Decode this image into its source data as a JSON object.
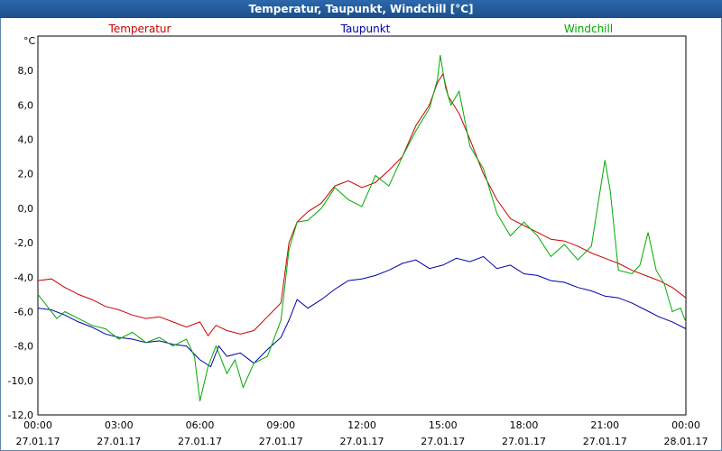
{
  "window": {
    "title": "Temperatur, Taupunkt, Windchill [°C]"
  },
  "chart_data": {
    "type": "line",
    "title": "Temperatur, Taupunkt, Windchill [°C]",
    "ylabel": "°C",
    "ylim": [
      -12,
      10
    ],
    "xlim": [
      0,
      24
    ],
    "yticks": [
      "-12,0",
      "-10,0",
      "-8,0",
      "-6,0",
      "-4,0",
      "-2,0",
      "0,0",
      "2,0",
      "4,0",
      "6,0",
      "8,0"
    ],
    "xticks": [
      {
        "time": "00:00",
        "date": "27.01.17"
      },
      {
        "time": "03:00",
        "date": "27.01.17"
      },
      {
        "time": "06:00",
        "date": "27.01.17"
      },
      {
        "time": "09:00",
        "date": "27.01.17"
      },
      {
        "time": "12:00",
        "date": "27.01.17"
      },
      {
        "time": "15:00",
        "date": "27.01.17"
      },
      {
        "time": "18:00",
        "date": "27.01.17"
      },
      {
        "time": "21:00",
        "date": "27.01.17"
      },
      {
        "time": "00:00",
        "date": "28.01.17"
      }
    ],
    "grid": true,
    "legend_position": "top",
    "series": [
      {
        "name": "Temperatur",
        "color": "#cc0000",
        "points": [
          [
            0,
            -4.2
          ],
          [
            0.5,
            -4.1
          ],
          [
            1,
            -4.6
          ],
          [
            1.5,
            -5.0
          ],
          [
            2,
            -5.3
          ],
          [
            2.5,
            -5.7
          ],
          [
            3,
            -5.9
          ],
          [
            3.5,
            -6.2
          ],
          [
            4,
            -6.4
          ],
          [
            4.5,
            -6.3
          ],
          [
            5,
            -6.6
          ],
          [
            5.5,
            -6.9
          ],
          [
            6,
            -6.6
          ],
          [
            6.3,
            -7.4
          ],
          [
            6.6,
            -6.8
          ],
          [
            7,
            -7.1
          ],
          [
            7.5,
            -7.3
          ],
          [
            8,
            -7.1
          ],
          [
            8.5,
            -6.3
          ],
          [
            9,
            -5.5
          ],
          [
            9.3,
            -2.0
          ],
          [
            9.6,
            -0.8
          ],
          [
            10,
            -0.2
          ],
          [
            10.5,
            0.3
          ],
          [
            11,
            1.3
          ],
          [
            11.5,
            1.6
          ],
          [
            12,
            1.2
          ],
          [
            12.5,
            1.5
          ],
          [
            13,
            2.2
          ],
          [
            13.5,
            3.0
          ],
          [
            14,
            4.8
          ],
          [
            14.5,
            6.0
          ],
          [
            14.8,
            7.3
          ],
          [
            15,
            7.8
          ],
          [
            15.2,
            6.5
          ],
          [
            15.6,
            5.5
          ],
          [
            16,
            4.0
          ],
          [
            16.5,
            2.0
          ],
          [
            17,
            0.5
          ],
          [
            17.5,
            -0.6
          ],
          [
            18,
            -1.0
          ],
          [
            18.5,
            -1.4
          ],
          [
            19,
            -1.8
          ],
          [
            19.5,
            -1.9
          ],
          [
            20,
            -2.2
          ],
          [
            20.5,
            -2.6
          ],
          [
            21,
            -2.9
          ],
          [
            21.5,
            -3.2
          ],
          [
            22,
            -3.6
          ],
          [
            22.5,
            -3.9
          ],
          [
            23,
            -4.2
          ],
          [
            23.5,
            -4.6
          ],
          [
            24,
            -5.2
          ]
        ]
      },
      {
        "name": "Taupunkt",
        "color": "#0000aa",
        "points": [
          [
            0,
            -5.8
          ],
          [
            0.5,
            -5.9
          ],
          [
            1,
            -6.2
          ],
          [
            1.5,
            -6.6
          ],
          [
            2,
            -6.9
          ],
          [
            2.5,
            -7.3
          ],
          [
            3,
            -7.5
          ],
          [
            3.5,
            -7.6
          ],
          [
            4,
            -7.8
          ],
          [
            4.5,
            -7.7
          ],
          [
            5,
            -7.9
          ],
          [
            5.5,
            -8.0
          ],
          [
            6,
            -8.8
          ],
          [
            6.4,
            -9.2
          ],
          [
            6.7,
            -8.0
          ],
          [
            7,
            -8.6
          ],
          [
            7.5,
            -8.4
          ],
          [
            8,
            -9.0
          ],
          [
            8.5,
            -8.2
          ],
          [
            9,
            -7.5
          ],
          [
            9.3,
            -6.5
          ],
          [
            9.6,
            -5.3
          ],
          [
            10,
            -5.8
          ],
          [
            10.5,
            -5.3
          ],
          [
            11,
            -4.7
          ],
          [
            11.5,
            -4.2
          ],
          [
            12,
            -4.1
          ],
          [
            12.5,
            -3.9
          ],
          [
            13,
            -3.6
          ],
          [
            13.5,
            -3.2
          ],
          [
            14,
            -3.0
          ],
          [
            14.5,
            -3.5
          ],
          [
            15,
            -3.3
          ],
          [
            15.5,
            -2.9
          ],
          [
            16,
            -3.1
          ],
          [
            16.5,
            -2.8
          ],
          [
            17,
            -3.5
          ],
          [
            17.5,
            -3.3
          ],
          [
            18,
            -3.8
          ],
          [
            18.5,
            -3.9
          ],
          [
            19,
            -4.2
          ],
          [
            19.5,
            -4.3
          ],
          [
            20,
            -4.6
          ],
          [
            20.5,
            -4.8
          ],
          [
            21,
            -5.1
          ],
          [
            21.5,
            -5.2
          ],
          [
            22,
            -5.5
          ],
          [
            22.5,
            -5.9
          ],
          [
            23,
            -6.3
          ],
          [
            23.5,
            -6.6
          ],
          [
            24,
            -7.0
          ]
        ]
      },
      {
        "name": "Windchill",
        "color": "#00aa00",
        "points": [
          [
            0,
            -5.0
          ],
          [
            0.3,
            -5.6
          ],
          [
            0.7,
            -6.4
          ],
          [
            1,
            -6.0
          ],
          [
            1.5,
            -6.4
          ],
          [
            2,
            -6.8
          ],
          [
            2.5,
            -7.0
          ],
          [
            3,
            -7.6
          ],
          [
            3.5,
            -7.2
          ],
          [
            4,
            -7.8
          ],
          [
            4.5,
            -7.5
          ],
          [
            5,
            -8.0
          ],
          [
            5.5,
            -7.6
          ],
          [
            5.8,
            -8.6
          ],
          [
            6,
            -11.2
          ],
          [
            6.3,
            -9.2
          ],
          [
            6.6,
            -8.0
          ],
          [
            7,
            -9.6
          ],
          [
            7.3,
            -8.8
          ],
          [
            7.6,
            -10.4
          ],
          [
            8,
            -9.0
          ],
          [
            8.5,
            -8.6
          ],
          [
            9,
            -6.5
          ],
          [
            9.3,
            -2.4
          ],
          [
            9.6,
            -0.8
          ],
          [
            10,
            -0.7
          ],
          [
            10.5,
            0.0
          ],
          [
            11,
            1.2
          ],
          [
            11.5,
            0.5
          ],
          [
            12,
            0.1
          ],
          [
            12.5,
            1.9
          ],
          [
            13,
            1.3
          ],
          [
            13.5,
            3.0
          ],
          [
            14,
            4.5
          ],
          [
            14.5,
            5.8
          ],
          [
            14.8,
            7.5
          ],
          [
            14.9,
            8.9
          ],
          [
            15.1,
            7.0
          ],
          [
            15.3,
            6.0
          ],
          [
            15.6,
            6.8
          ],
          [
            16,
            3.6
          ],
          [
            16.5,
            2.3
          ],
          [
            17,
            -0.3
          ],
          [
            17.5,
            -1.6
          ],
          [
            18,
            -0.8
          ],
          [
            18.5,
            -1.6
          ],
          [
            19,
            -2.8
          ],
          [
            19.5,
            -2.1
          ],
          [
            20,
            -3.0
          ],
          [
            20.5,
            -2.2
          ],
          [
            21,
            2.8
          ],
          [
            21.2,
            1.0
          ],
          [
            21.5,
            -3.6
          ],
          [
            22,
            -3.8
          ],
          [
            22.3,
            -3.3
          ],
          [
            22.6,
            -1.4
          ],
          [
            22.9,
            -3.6
          ],
          [
            23.2,
            -4.4
          ],
          [
            23.5,
            -6.0
          ],
          [
            23.8,
            -5.8
          ],
          [
            24,
            -6.6
          ]
        ]
      }
    ]
  }
}
